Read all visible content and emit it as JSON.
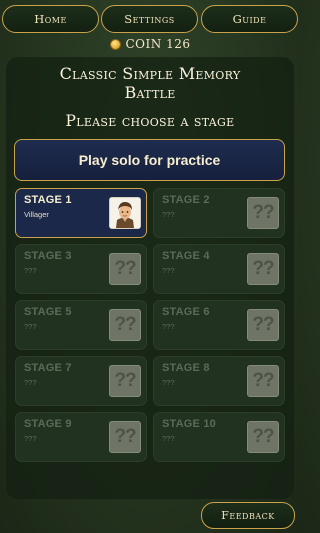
{
  "nav": {
    "home_label": "Home",
    "settings_label": "Settings",
    "guide_label": "Guide"
  },
  "coin": {
    "label": "COIN 126"
  },
  "main": {
    "title_line1": "Classic Simple Memory",
    "title_line2": "Battle",
    "subtitle": "Please choose a stage",
    "solo_label": "Play solo for practice"
  },
  "stages": [
    {
      "name": "STAGE 1",
      "sub": "Villager",
      "locked": false,
      "icon": "villager-portrait"
    },
    {
      "name": "STAGE 2",
      "sub": "???",
      "locked": true,
      "icon": "question-mark"
    },
    {
      "name": "STAGE 3",
      "sub": "???",
      "locked": true,
      "icon": "question-mark"
    },
    {
      "name": "STAGE 4",
      "sub": "???",
      "locked": true,
      "icon": "question-mark"
    },
    {
      "name": "STAGE 5",
      "sub": "???",
      "locked": true,
      "icon": "question-mark"
    },
    {
      "name": "STAGE 6",
      "sub": "???",
      "locked": true,
      "icon": "question-mark"
    },
    {
      "name": "STAGE 7",
      "sub": "???",
      "locked": true,
      "icon": "question-mark"
    },
    {
      "name": "STAGE 8",
      "sub": "???",
      "locked": true,
      "icon": "question-mark"
    },
    {
      "name": "STAGE 9",
      "sub": "???",
      "locked": true,
      "icon": "question-mark"
    },
    {
      "name": "STAGE 10",
      "sub": "???",
      "locked": true,
      "icon": "question-mark"
    }
  ],
  "locked_glyph": "??",
  "footer": {
    "feedback_label": "Feedback"
  },
  "colors": {
    "gold_border": "#c9a24a",
    "active_stage_bg": "#1b284a",
    "locked_stage_bg": "#223221",
    "background": "#25351f"
  }
}
